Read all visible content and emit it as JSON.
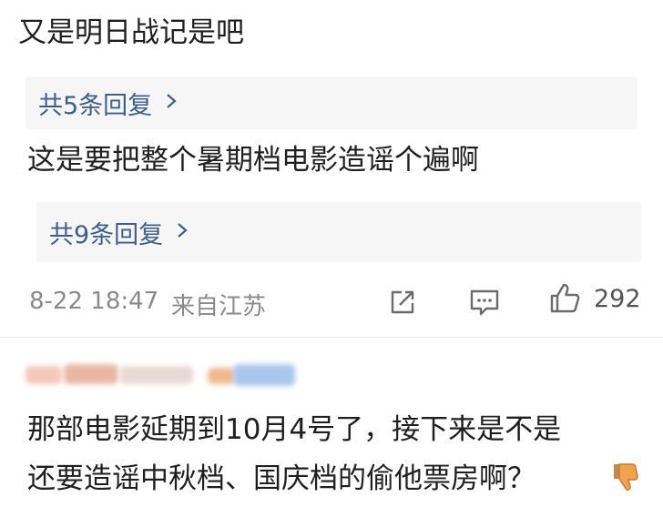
{
  "comments": {
    "c1": {
      "text": "又是明日战记是吧",
      "replies_label": "共5条回复"
    },
    "c2": {
      "text": "这是要把整个暑期档电影造谣个遍啊",
      "replies_label": "共9条回复"
    }
  },
  "meta": {
    "timestamp": "8-22 18:47",
    "location": "来自江苏",
    "like_count": "292"
  },
  "next_comment": {
    "line1": "那部电影延期到10月4号了，接下来是不是",
    "line2": "还要造谣中秋档、国庆档的偷他票房啊？"
  },
  "icons": {
    "share": "share-icon",
    "comment": "comment-icon",
    "like": "like-icon",
    "chevron": "chevron-right-icon",
    "emoji": "thumbs-down-emoji-icon"
  },
  "colors": {
    "link": "#3d5f8f",
    "meta": "#8a8a8a",
    "reply_bg": "#f6f6f6"
  }
}
